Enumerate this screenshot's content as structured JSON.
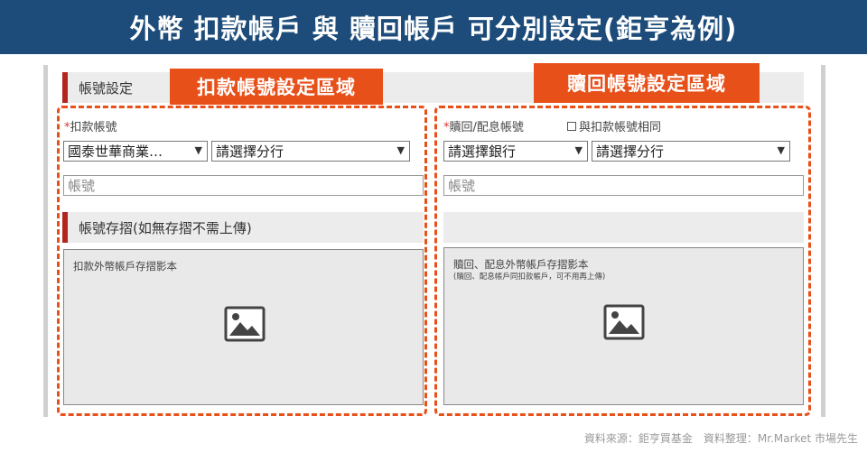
{
  "banner": {
    "title": "外幣 扣款帳戶 與 贖回帳戶 可分別設定(鉅亨為例)"
  },
  "annotations": {
    "debit_area": "扣款帳號設定區域",
    "redeem_area": "贖回帳號設定區域"
  },
  "form": {
    "section_title": "帳號設定",
    "debit": {
      "required_mark": "*",
      "label": "扣款帳號",
      "bank_select": "國泰世華商業…",
      "branch_select": "請選擇分行",
      "account_placeholder": "帳號"
    },
    "redeem": {
      "required_mark": "*",
      "label": "贖回/配息帳號",
      "same_as_debit": "與扣款帳號相同",
      "bank_select": "請選擇銀行",
      "branch_select": "請選擇分行",
      "account_placeholder": "帳號"
    },
    "passbook_section_title": "帳號存摺(如無存摺不需上傳)",
    "upload_debit": {
      "text": "扣款外幣帳戶存摺影本"
    },
    "upload_redeem": {
      "text": "贖回、配息外幣帳戶存摺影本",
      "subtext": "(贖回、配息帳戶同扣款帳戶，可不用再上傳)"
    }
  },
  "footer": {
    "credit": "資料來源：鉅亨買基金　資料整理：Mr.Market 市場先生"
  },
  "colors": {
    "banner": "#1d4c7a",
    "accent_orange": "#e8501a",
    "header_bar": "#b3261e"
  },
  "icons": {
    "chevron": "chevron-down-icon",
    "image": "image-placeholder-icon"
  }
}
